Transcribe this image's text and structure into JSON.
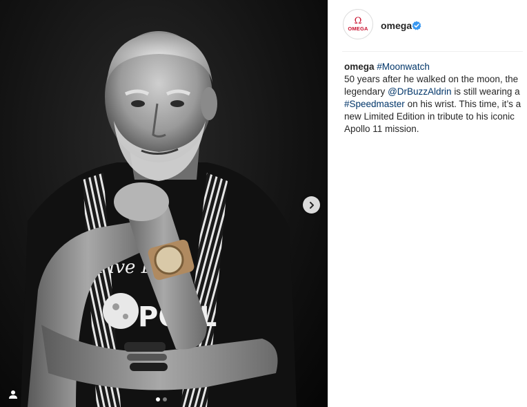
{
  "post": {
    "account": {
      "username": "omega",
      "avatar_symbol": "Ω",
      "avatar_text": "OMEGA",
      "verified_icon": "verified-badge-icon",
      "brand_color": "#c8102e",
      "verified_color": "#3897f0"
    },
    "caption": {
      "username": "omega",
      "hashtag1": "#Moonwatch",
      "text1": "50 years after he walked on the moon, the legendary",
      "mention": "@DrBuzzAldrin",
      "text2": "is still wearing a",
      "hashtag2": "#Speedmaster",
      "text3": "on his wrist. This time, it’s a new Limited Edition in tribute to his iconic Apollo 11 mission.",
      "link_color": "#003569"
    },
    "media": {
      "next_icon": "chevron-right-icon",
      "tag_icon": "user-tag-icon",
      "slide_count": 2,
      "active_slide": 1,
      "shirt_text_1": "Five D",
      "shirt_text_2": "POLL"
    }
  }
}
